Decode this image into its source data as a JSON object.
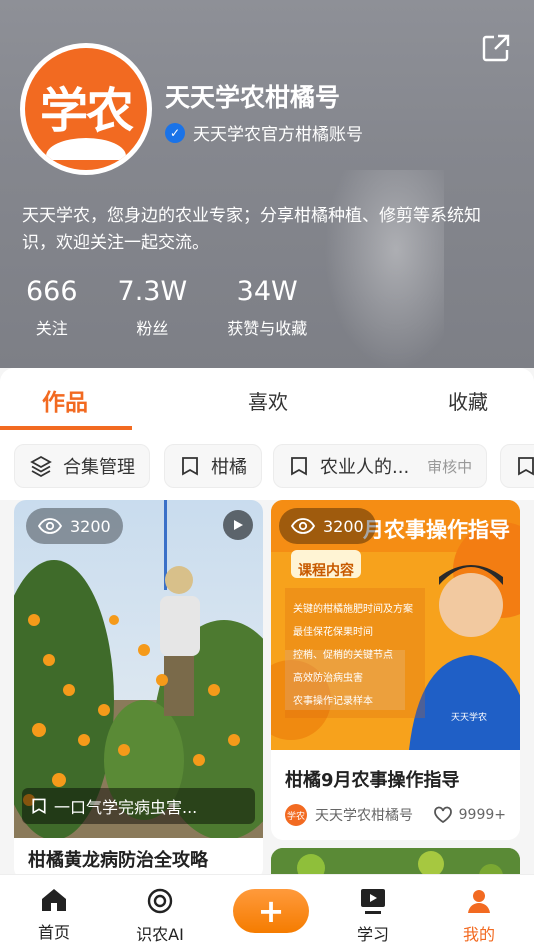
{
  "profile": {
    "avatar_text": "学农",
    "name": "天天学农柑橘号",
    "verified_label": "天天学农官方柑橘账号",
    "bio": "天天学农，您身边的农业专家；分享柑橘种植、修剪等系统知识，欢迎关注一起交流。",
    "stats": [
      {
        "value": "666",
        "label": "关注"
      },
      {
        "value": "7.3W",
        "label": "粉丝"
      },
      {
        "value": "34W",
        "label": "获赞与收藏"
      }
    ]
  },
  "tabs": [
    "作品",
    "喜欢",
    "收藏"
  ],
  "chips": [
    {
      "label": "合集管理"
    },
    {
      "label": "柑橘"
    },
    {
      "label": "农业人的...",
      "status": "审核中"
    }
  ],
  "cards": {
    "left": {
      "views": "3200",
      "caption": "一口气学完病虫害...",
      "title": "柑橘黄龙病防治全攻略"
    },
    "right": {
      "views": "3200",
      "poster_title": "月农事操作指导",
      "poster_tag": "课程内容",
      "poster_points": [
        "关键的柑橘施肥时间及方案",
        "最佳保花保果时间",
        "控梢、促梢的关键节点",
        "高效防治病虫害",
        "农事操作记录样本"
      ],
      "shirt_logo": "天天学农",
      "title": "柑橘9月农事操作指导",
      "author": "天天学农柑橘号",
      "author_badge": "学农",
      "likes": "9999+"
    }
  },
  "bottom_nav": [
    {
      "label": "首页"
    },
    {
      "label": "识农AI"
    },
    {
      "label": "+"
    },
    {
      "label": "学习"
    },
    {
      "label": "我的"
    }
  ],
  "colors": {
    "accent": "#f26a21",
    "verify": "#1a73e8"
  }
}
